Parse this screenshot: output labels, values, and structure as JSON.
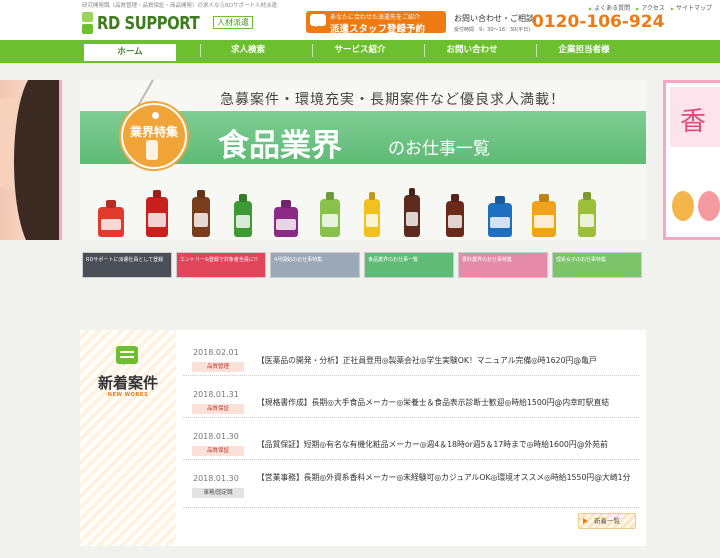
{
  "header": {
    "tagline": "研究開発職（品質管理・品質保証・商品開発）の求人ならRDサポート人材派遣",
    "logo_text": "RD SUPPORT",
    "logo_badge": "人材派遣",
    "top_links": [
      "よくある質問",
      "アクセス",
      "サイトマップ"
    ],
    "reserve": {
      "line1": "あなたに合わせた派遣先をご紹介",
      "line2": "派遣スタッフ登録予約"
    },
    "contact_label": "お問い合わせ・ご相談",
    "contact_hours": "受付時間　9：30〜18：30(平日)",
    "phone": "0120-106-924",
    "accent_color": "#6cbf2f",
    "phone_color": "#f07a12"
  },
  "nav": {
    "items": [
      {
        "label": "ホーム"
      },
      {
        "label": "求人検索"
      },
      {
        "label": "サービス紹介"
      },
      {
        "label": "お問い合わせ"
      },
      {
        "label": "企業担当者様"
      }
    ]
  },
  "hero": {
    "headline": "急募案件・環境充実・長期案件など優良求人満載！",
    "tag_label": "業界特集",
    "title": "食品業界",
    "subtitle": "のお仕事一覧",
    "side_text": "香"
  },
  "banners": [
    {
      "text": "RDサポートに派遣社員として登録",
      "color": "#4b4f58"
    },
    {
      "text": "エントリー&登録で対象者全員に!!",
      "color": "#e0455a"
    },
    {
      "text": "4月開始のお仕事特集",
      "color": "#9aa8b8"
    },
    {
      "text": "食品業界のお仕事一覧",
      "color": "#5fbb76"
    },
    {
      "text": "香料業界のお仕事特集",
      "color": "#e58aa8"
    },
    {
      "text": "理系女子のお仕事特集",
      "color": "#7cc36a"
    }
  ],
  "news": {
    "title": "新着案件",
    "subtitle": "NEW WORKS",
    "items": [
      {
        "date": "2018.02.01",
        "category": "品質管理",
        "text": "【医薬品の開発・分析】正社員登用◎製薬会社◎学生実験OK！マニュアル完備◎時1620円@亀戸"
      },
      {
        "date": "2018.01.31",
        "category": "品質保証",
        "text": "【規格書作成】長期◎大手食品メーカー◎栄養士＆食品表示診断士歓迎◎時給1500円@内幸町駅直結"
      },
      {
        "date": "2018.01.30",
        "category": "品質保証",
        "text": "【品質保証】短期◎有名な有機化粧品メーカー◎週4＆18時or週5＆17時まで◎時給1600円@外苑前"
      },
      {
        "date": "2018.01.30",
        "category": "事務/固定職",
        "text": "【営業事務】長期◎外資系香料メーカー◎未経験可◎カジュアルOK◎環境オススメ◎時給1550円@大崎1分"
      }
    ],
    "more_label": "新着一覧"
  }
}
